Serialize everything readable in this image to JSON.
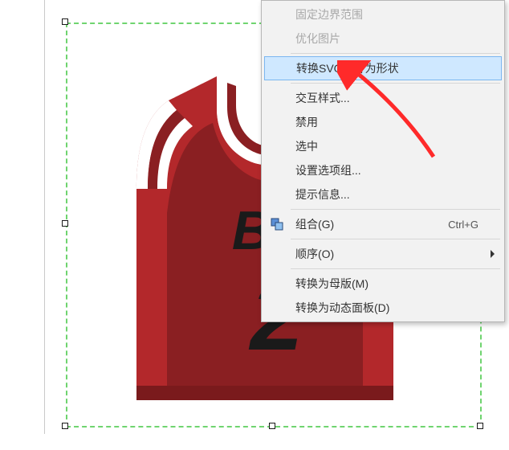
{
  "menu": {
    "items": [
      {
        "label": "固定边界范围",
        "state": "disabled"
      },
      {
        "label": "优化图片",
        "state": "disabled"
      },
      "---",
      {
        "label": "转换SVG图片为形状",
        "state": "highlight"
      },
      "---",
      {
        "label": "交互样式..."
      },
      {
        "label": "禁用"
      },
      {
        "label": "选中"
      },
      {
        "label": "设置选项组..."
      },
      {
        "label": "提示信息..."
      },
      "---",
      {
        "label": "组合(G)",
        "shortcut": "Ctrl+G",
        "icon": "group"
      },
      "---",
      {
        "label": "顺序(O)",
        "submenu": true
      },
      "---",
      {
        "label": "转换为母版(M)"
      },
      {
        "label": "转换为动态面板(D)"
      }
    ]
  },
  "jersey": {
    "text_top": "BU",
    "text_num": "2"
  },
  "colors": {
    "highlight_bg": "#cfe8ff",
    "highlight_border": "#7bb6f0",
    "selection_dash": "#6fd46f",
    "jersey_red": "#b3282b",
    "jersey_dark": "#8a1f22",
    "arrow": "#ff2a2a"
  }
}
